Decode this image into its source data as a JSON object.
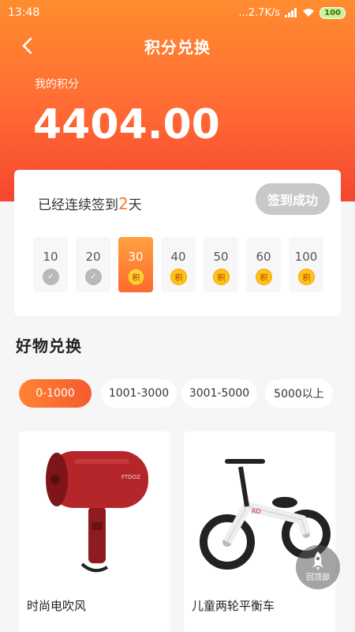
{
  "status": {
    "time": "13:48",
    "speed": "...2.7K/s",
    "battery": "100"
  },
  "header": {
    "title": "积分兑换"
  },
  "points": {
    "label": "我的积分",
    "value": "4404.00"
  },
  "signin": {
    "prefix": "已经连续签到",
    "days": "2",
    "suffix": "天",
    "button": "签到成功",
    "steps": [
      {
        "value": "10",
        "state": "done"
      },
      {
        "value": "20",
        "state": "done"
      },
      {
        "value": "30",
        "state": "current",
        "badge": "积"
      },
      {
        "value": "40",
        "state": "pending",
        "badge": "积"
      },
      {
        "value": "50",
        "state": "pending",
        "badge": "积"
      },
      {
        "value": "60",
        "state": "pending",
        "badge": "积"
      },
      {
        "value": "100",
        "state": "pending",
        "badge": "积"
      }
    ]
  },
  "section": {
    "title": "好物兑换"
  },
  "tabs": [
    "0-1000",
    "1001-3000",
    "3001-5000",
    "5000以上"
  ],
  "products": [
    {
      "name": "时尚电吹风",
      "icon": "hair-dryer"
    },
    {
      "name": "儿童两轮平衡车",
      "icon": "balance-bike"
    }
  ],
  "back_to_top": {
    "label": "回顶部"
  },
  "colors": {
    "accent": "#ff6a34",
    "highlight": "#ff7a25",
    "disabled": "#c8c8c8"
  }
}
